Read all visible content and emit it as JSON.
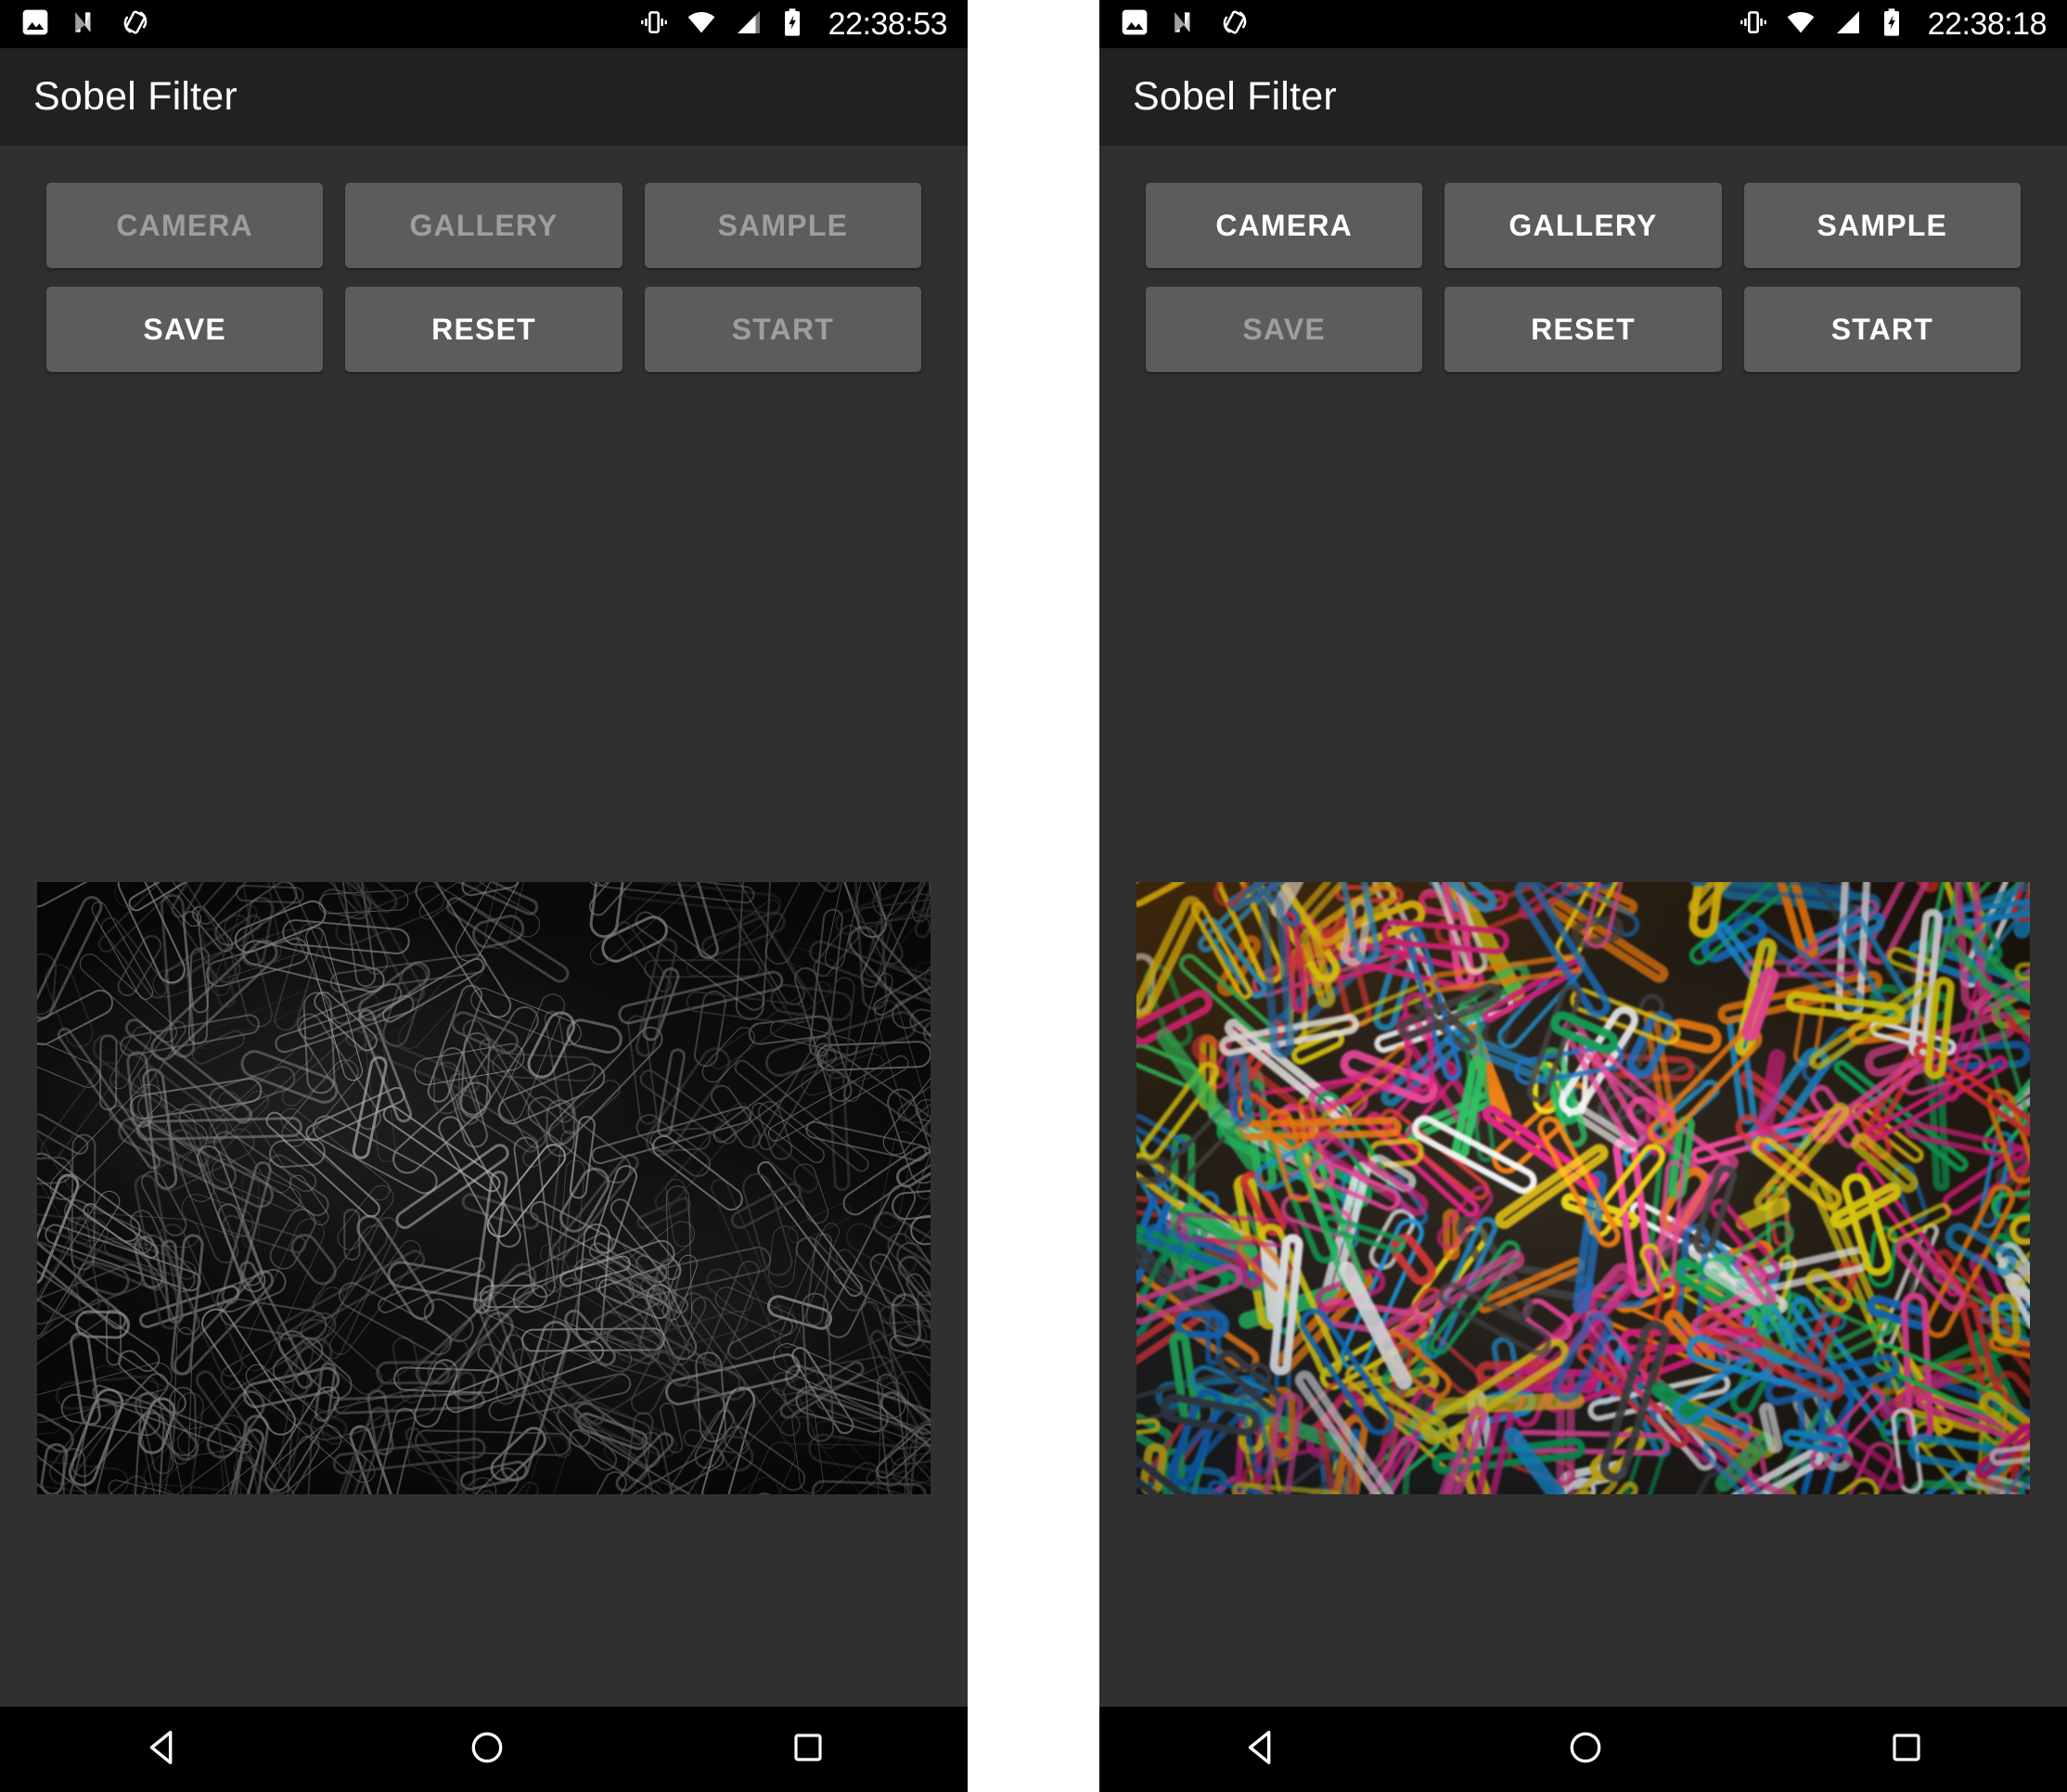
{
  "panels": [
    {
      "id": "left-panel",
      "statusbar": {
        "time": "22:38:53",
        "left_icons": [
          "photo-icon",
          "android-nougat-icon",
          "auto-rotate-icon"
        ],
        "right_icons": [
          "vibrate-icon",
          "wifi-icon",
          "cell-signal-icon",
          "battery-charging-icon"
        ],
        "signal_bars": "partial"
      },
      "appbar": {
        "title": "Sobel Filter"
      },
      "buttons": [
        {
          "label": "CAMERA",
          "enabled": false
        },
        {
          "label": "GALLERY",
          "enabled": false
        },
        {
          "label": "SAMPLE",
          "enabled": false
        },
        {
          "label": "SAVE",
          "enabled": true
        },
        {
          "label": "RESET",
          "enabled": true
        },
        {
          "label": "START",
          "enabled": false
        }
      ],
      "preview": {
        "kind": "sobel-edge-paperclips",
        "alt": "Sobel edge-detected paperclips"
      },
      "navbar": [
        "back-icon",
        "home-icon",
        "recents-icon"
      ]
    },
    {
      "id": "right-panel",
      "statusbar": {
        "time": "22:38:18",
        "left_icons": [
          "photo-icon",
          "android-nougat-icon",
          "auto-rotate-icon"
        ],
        "right_icons": [
          "vibrate-icon",
          "wifi-icon",
          "cell-signal-icon",
          "battery-charging-icon"
        ],
        "signal_bars": "full"
      },
      "appbar": {
        "title": "Sobel Filter"
      },
      "buttons": [
        {
          "label": "CAMERA",
          "enabled": true
        },
        {
          "label": "GALLERY",
          "enabled": true
        },
        {
          "label": "SAMPLE",
          "enabled": true
        },
        {
          "label": "SAVE",
          "enabled": false
        },
        {
          "label": "RESET",
          "enabled": true
        },
        {
          "label": "START",
          "enabled": true
        }
      ],
      "preview": {
        "kind": "color-paperclips",
        "alt": "Colorful paperclips photograph"
      },
      "navbar": [
        "back-icon",
        "home-icon",
        "recents-icon"
      ]
    }
  ],
  "colors": {
    "status_bar": "#000000",
    "action_bar": "#212121",
    "background": "#303030",
    "button_face": "#5c5c5c",
    "button_text_enabled": "#ffffff",
    "button_text_disabled": "#9e9e9e",
    "nav_bar": "#000000",
    "gutter": "#ffffff"
  }
}
